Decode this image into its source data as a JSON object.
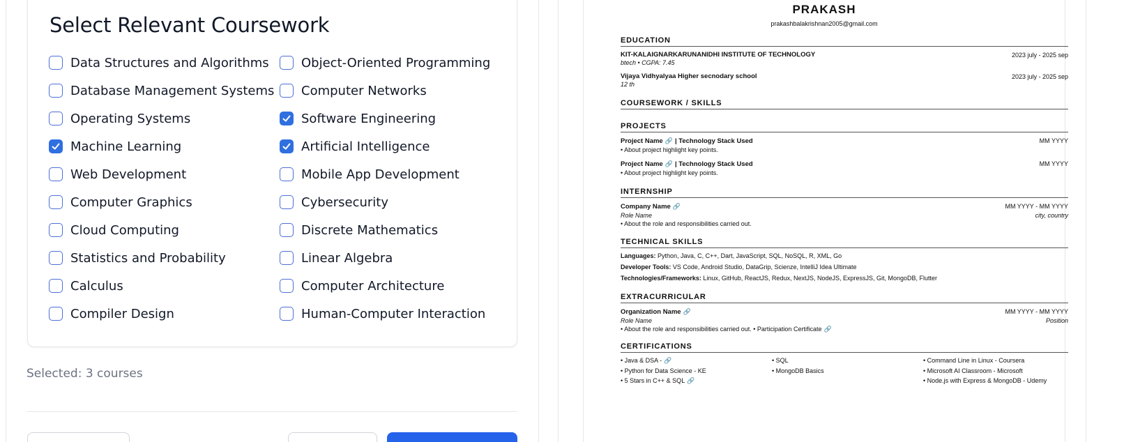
{
  "coursework": {
    "title": "Select Relevant Coursework",
    "courses": [
      {
        "label": "Data Structures and Algorithms",
        "checked": false
      },
      {
        "label": "Object-Oriented Programming",
        "checked": false
      },
      {
        "label": "Database Management Systems",
        "checked": false
      },
      {
        "label": "Computer Networks",
        "checked": false
      },
      {
        "label": "Operating Systems",
        "checked": false
      },
      {
        "label": "Software Engineering",
        "checked": true
      },
      {
        "label": "Machine Learning",
        "checked": true
      },
      {
        "label": "Artificial Intelligence",
        "checked": true
      },
      {
        "label": "Web Development",
        "checked": false
      },
      {
        "label": "Mobile App Development",
        "checked": false
      },
      {
        "label": "Computer Graphics",
        "checked": false
      },
      {
        "label": "Cybersecurity",
        "checked": false
      },
      {
        "label": "Cloud Computing",
        "checked": false
      },
      {
        "label": "Discrete Mathematics",
        "checked": false
      },
      {
        "label": "Statistics and Probability",
        "checked": false
      },
      {
        "label": "Linear Algebra",
        "checked": false
      },
      {
        "label": "Calculus",
        "checked": false
      },
      {
        "label": "Computer Architecture",
        "checked": false
      },
      {
        "label": "Compiler Design",
        "checked": false
      },
      {
        "label": "Human-Computer Interaction",
        "checked": false
      }
    ],
    "selected_text": "Selected: 3 courses",
    "accent_color": "#2f6fe0",
    "primary_button_color": "#2563eb"
  },
  "resume": {
    "name": "PRAKASH",
    "email": "prakashbalakrishnan2005@gmail.com",
    "education": {
      "heading": "EDUCATION",
      "entries": [
        {
          "school": "KIT-KALAIGNARKARUNANIDHI INSTITUTE OF TECHNOLOGY",
          "dates": "2023 july - 2025 sep",
          "detail": "btech • CGPA: 7.45"
        },
        {
          "school": "Vijaya Vidhyalyaa Higher secnodary school",
          "dates": "2023 july - 2025 sep",
          "detail": "12 th"
        }
      ]
    },
    "coursework_heading": "COURSEWORK / SKILLS",
    "projects": {
      "heading": "PROJECTS",
      "entries": [
        {
          "name": "Project Name",
          "stack": "| Technology Stack Used",
          "date": "MM YYYY",
          "bullet": "• About project highlight key points."
        },
        {
          "name": "Project Name",
          "stack": "| Technology Stack Used",
          "date": "MM YYYY",
          "bullet": "• About project highlight key points."
        }
      ]
    },
    "internship": {
      "heading": "INTERNSHIP",
      "company": "Company Name",
      "dates": "MM YYYY - MM YYYY",
      "role": "Role Name",
      "location": "city, country",
      "bullet": "• About the role and responsibilities carried out."
    },
    "technical_skills": {
      "heading": "TECHNICAL SKILLS",
      "rows": [
        {
          "label": "Languages:",
          "value": "Python, Java, C, C++, Dart, JavaScript, SQL, NoSQL, R, XML, Go"
        },
        {
          "label": "Developer Tools:",
          "value": "VS Code, Android Studio, DataGrip, Scienze, IntelliJ Idea Ultimate"
        },
        {
          "label": "Technologies/Frameworks:",
          "value": "Linux, GitHub, ReactJS, Redux, NextJS, NodeJS, ExpressJS, Git, MongoDB, Flutter"
        }
      ]
    },
    "extracurricular": {
      "heading": "EXTRACURRICULAR",
      "org": "Organization Name",
      "dates": "MM YYYY - MM YYYY",
      "role": "Role Name",
      "position": "Position",
      "bullet": "• About the role and responsibilities carried out. • Participation Certificate"
    },
    "certifications": {
      "heading": "CERTIFICATIONS",
      "items": [
        "• Java & DSA -",
        "• SQL",
        "• Command Line in Linux - Coursera",
        "• Python for Data Science - KE",
        "• MongoDB Basics",
        "• Microsoft AI Classroom - Microsoft",
        "• 5 Stars in C++ & SQL",
        "",
        "• Node.js with Express & MongoDB - Udemy"
      ]
    }
  }
}
